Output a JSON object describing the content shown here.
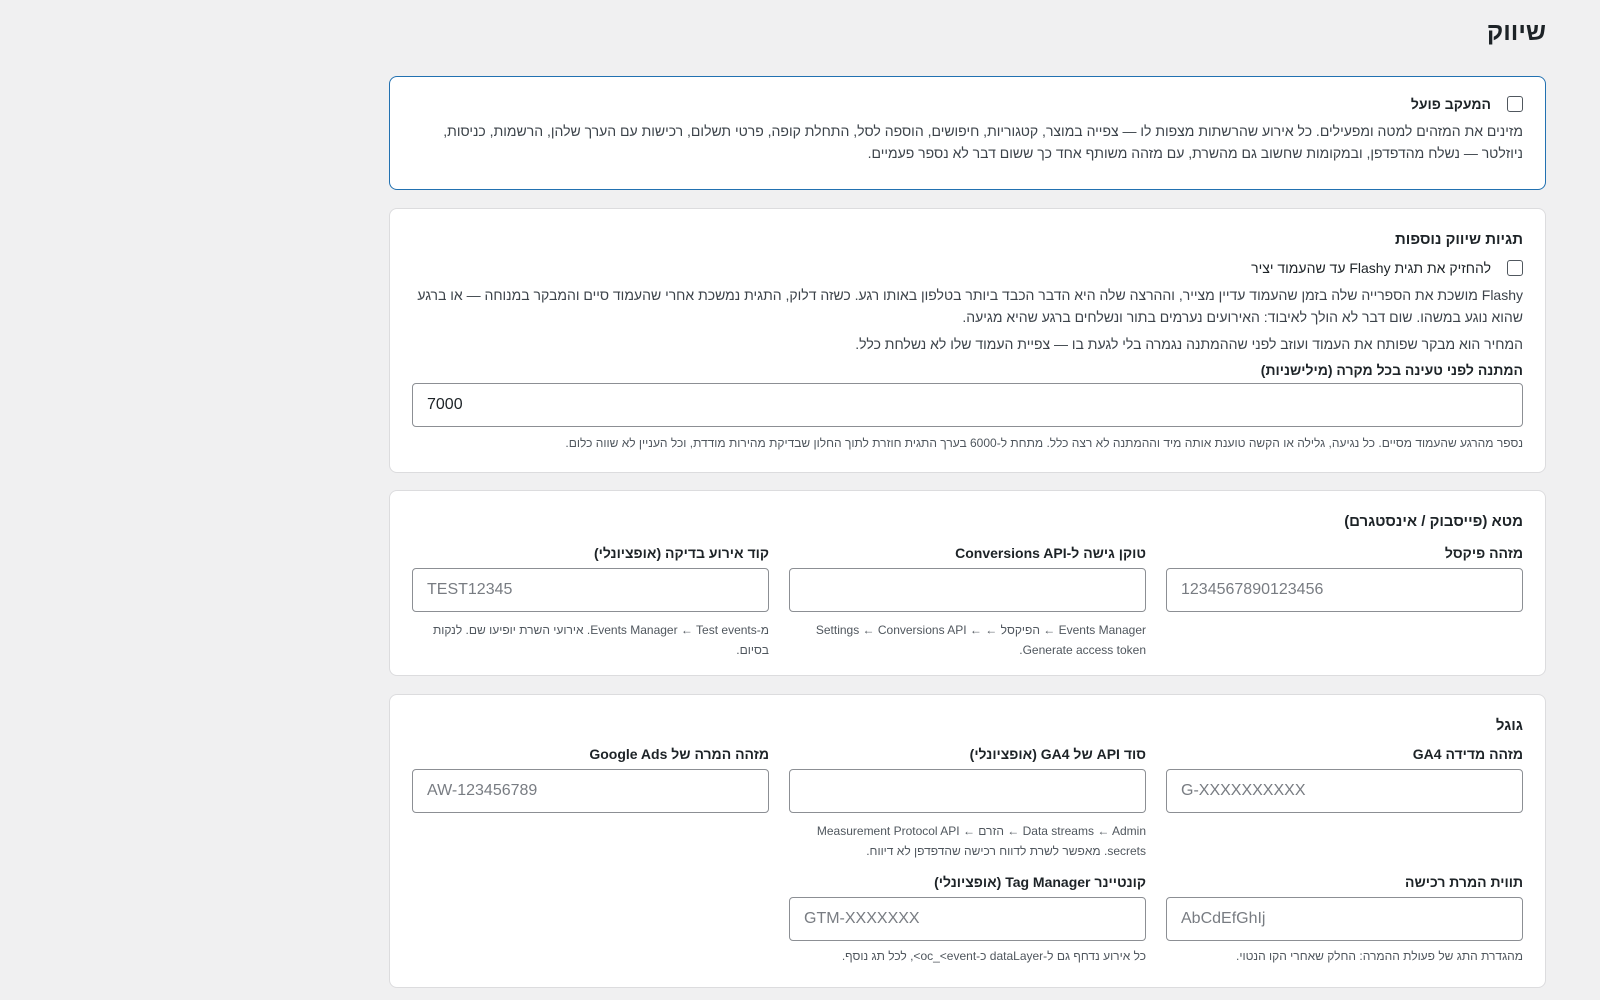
{
  "page": {
    "title": "שיווק"
  },
  "tracking": {
    "label": "המעקב פועל",
    "description": "מזינים את המזהים למטה ומפעילים. כל אירוע שהרשתות מצפות לו — צפייה במוצר, קטגוריות, חיפושים, הוספה לסל, התחלת קופה, פרטי תשלום, רכישות עם הערך שלהן, הרשמות, כניסות, ניוזלטר — נשלח מהדפדפן, ובמקומות שחשוב גם מהשרת, עם מזהה משותף אחד כך ששום דבר לא נספר פעמיים."
  },
  "extra_tags": {
    "title": "תגיות שיווק נוספות",
    "flashy_label": "להחזיק את תגית Flashy עד שהעמוד יציר",
    "description1": "Flashy מושכת את הספרייה שלה בזמן שהעמוד עדיין מצייר, וההרצה שלה היא הדבר הכבד ביותר בטלפון באותו רגע. כשזה דלוק, התגית נמשכת אחרי שהעמוד סיים והמבקר במנוחה — או ברגע שהוא נוגע במשהו. שום דבר לא הולך לאיבוד: האירועים נערמים בתור ונשלחים ברגע שהיא מגיעה.",
    "description2": "המחיר הוא מבקר שפותח את העמוד ועוזב לפני שההמתנה נגמרה בלי לגעת בו — צפיית העמוד שלו לא נשלחת כלל.",
    "wait_label": "המתנה לפני טעינה בכל מקרה (מילישניות)",
    "wait_value": "7000",
    "wait_hint": "נספר מהרגע שהעמוד מסיים. כל נגיעה, גלילה או הקשה טוענת אותה מיד וההמתנה לא רצה כלל. מתחת ל-6000 בערך התגית חוזרת לתוך החלון שבדיקת מהירות מודדת, וכל העניין לא שווה כלום."
  },
  "meta": {
    "title": "מטא (פייסבוק / אינסטגרם)",
    "pixel": {
      "label": "מזהה פיקסל",
      "placeholder": "1234567890123456"
    },
    "capi": {
      "label": "טוקן גישה ל-Conversions API",
      "placeholder": "",
      "hint": "Events Manager ← הפיקסל ← Settings ← Conversions API ← Generate access token."
    },
    "test": {
      "label": "קוד אירוע בדיקה (אופציונלי)",
      "placeholder": "TEST12345",
      "hint": "מ-Events Manager ← Test events. אירועי השרת יופיעו שם. לנקות בסיום."
    }
  },
  "google": {
    "title": "גוגל",
    "ga4": {
      "label": "מזהה מדידה GA4",
      "placeholder": "G-XXXXXXXXXX"
    },
    "api_secret": {
      "label": "סוד API של GA4 (אופציונלי)",
      "placeholder": "",
      "hint": "Data streams ← Admin ← הזרם ← Measurement Protocol API secrets. מאפשר לשרת לדווח רכישה שהדפדפן לא דיווח."
    },
    "ads": {
      "label": "מזהה המרה של Google Ads",
      "placeholder": "AW-123456789"
    },
    "conv_label": {
      "label": "תווית המרת רכישה",
      "placeholder": "AbCdEfGhIj",
      "hint": "מהגדרת התג של פעולת ההמרה: החלק שאחרי הקו הנטוי."
    },
    "gtm": {
      "label": "קונטיינר Tag Manager (אופציונלי)",
      "placeholder": "GTM-XXXXXXX",
      "hint": "כל אירוע נדחף גם ל-dataLayer כ-oc_<event>, לכל תג נוסף."
    }
  }
}
